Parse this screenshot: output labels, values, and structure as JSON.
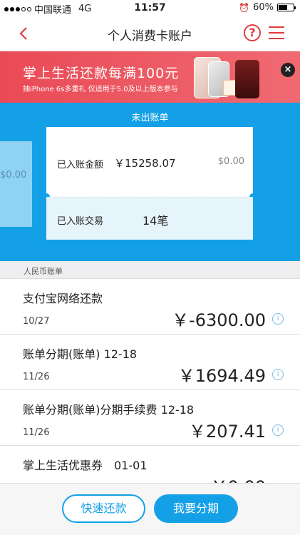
{
  "status_bar": {
    "carrier": "中国联通",
    "network": "4G",
    "time": "11:57",
    "battery": "60%",
    "battery_level": 0.6
  },
  "nav": {
    "title": "个人消费卡账户",
    "help_icon": "?"
  },
  "banner": {
    "headline": "掌上生活还款每满100元",
    "subtext": "抽iPhone 6s多重礼 仅适用于5.0及以上版本参与",
    "close_icon": "×"
  },
  "bill": {
    "label": "未出账单",
    "side_amount": "$0.00",
    "posted_amount_label": "已入账金额",
    "posted_amount_cny": "￥15258.07",
    "posted_amount_usd": "$0.00",
    "posted_txn_label": "已入账交易",
    "posted_txn_count": "14笔"
  },
  "section": {
    "title": "人民币账单"
  },
  "transactions": [
    {
      "desc": "支付宝网络还款",
      "date": "10/27",
      "amount": "￥-6300.00"
    },
    {
      "desc": "账单分期(账单) 12-18",
      "date": "11/26",
      "amount": "￥1694.49"
    },
    {
      "desc": "账单分期(账单)分期手续费 12-18",
      "date": "11/26",
      "amount": "￥207.41"
    },
    {
      "desc": "掌上生活优惠券　01-01",
      "date": "",
      "amount": "￥0.00"
    }
  ],
  "actions": {
    "quick_repay": "快速还款",
    "installment": "我要分期"
  },
  "colors": {
    "accent_blue": "#14a0e6",
    "nav_red": "#e03c3c",
    "banner_red": "#e94a56"
  }
}
